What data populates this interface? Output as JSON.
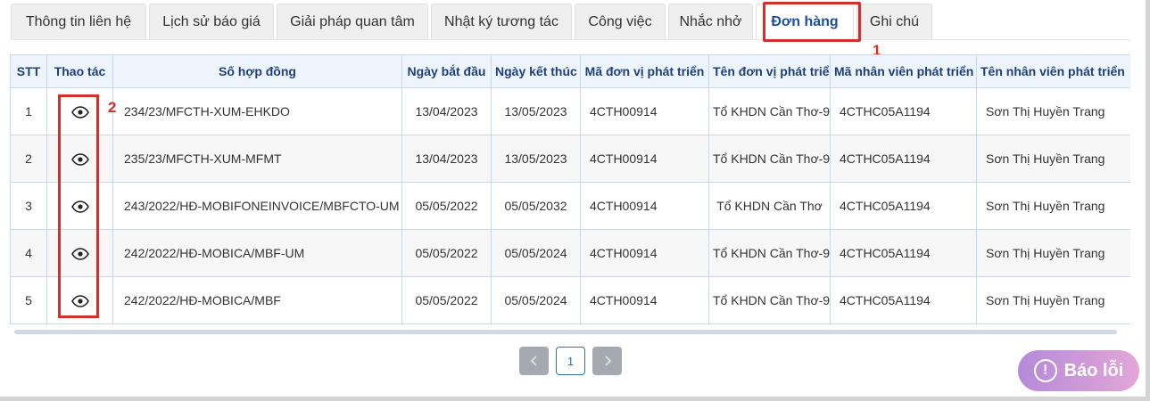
{
  "tabs": [
    {
      "label": "Thông tin liên hệ"
    },
    {
      "label": "Lịch sử báo giá"
    },
    {
      "label": "Giải pháp quan tâm"
    },
    {
      "label": "Nhật ký tương tác"
    },
    {
      "label": "Công việc"
    },
    {
      "label": "Nhắc nhở"
    },
    {
      "label": "Đơn hàng"
    },
    {
      "label": "Ghi chú"
    }
  ],
  "annotations": {
    "tab": "1",
    "column": "2"
  },
  "table": {
    "headers": [
      "STT",
      "Thao tác",
      "Số hợp đồng",
      "Ngày bắt đầu",
      "Ngày kết thúc",
      "Mã đơn vị phát triển",
      "Tên đơn vị phát triển",
      "Mã nhân viên phát triển",
      "Tên nhân viên phát triển"
    ],
    "rows": [
      {
        "stt": "1",
        "contract": "234/23/MFCTH-XUM-EHKDO",
        "start": "13/04/2023",
        "end": "13/05/2023",
        "unit_code": "4CTH00914",
        "unit_name": "Tổ KHDN Cần Thơ-9",
        "staff_code": "4CTHC05A1194",
        "staff_name": "Sơn Thị Huyền Trang"
      },
      {
        "stt": "2",
        "contract": "235/23/MFCTH-XUM-MFMT",
        "start": "13/04/2023",
        "end": "13/05/2023",
        "unit_code": "4CTH00914",
        "unit_name": "Tổ KHDN Cần Thơ-9",
        "staff_code": "4CTHC05A1194",
        "staff_name": "Sơn Thị Huyền Trang"
      },
      {
        "stt": "3",
        "contract": "243/2022/HĐ-MOBIFONEINVOICE/MBFCTO-UM",
        "start": "05/05/2022",
        "end": "05/05/2032",
        "unit_code": "4CTH00914",
        "unit_name": "Tổ KHDN Cần Thơ",
        "staff_code": "4CTHC05A1194",
        "staff_name": "Sơn Thị Huyền Trang"
      },
      {
        "stt": "4",
        "contract": "242/2022/HĐ-MOBICA/MBF-UM",
        "start": "05/05/2022",
        "end": "05/05/2024",
        "unit_code": "4CTH00914",
        "unit_name": "Tổ KHDN Cần Thơ-9",
        "staff_code": "4CTHC05A1194",
        "staff_name": "Sơn Thị Huyền Trang"
      },
      {
        "stt": "5",
        "contract": "242/2022/HĐ-MOBICA/MBF",
        "start": "05/05/2022",
        "end": "05/05/2024",
        "unit_code": "4CTH00914",
        "unit_name": "Tổ KHDN Cần Thơ-9",
        "staff_code": "4CTHC05A1194",
        "staff_name": "Sơn Thị Huyền Trang"
      }
    ]
  },
  "pagination": {
    "prev_icon": "chevron-left-icon",
    "current": "1",
    "next_icon": "chevron-right-icon"
  },
  "report_button": {
    "label": "Báo lỗi",
    "icon": "exclamation-circle-icon"
  },
  "colors": {
    "accent": "#1e4f9c",
    "highlight": "#d32f2f"
  }
}
